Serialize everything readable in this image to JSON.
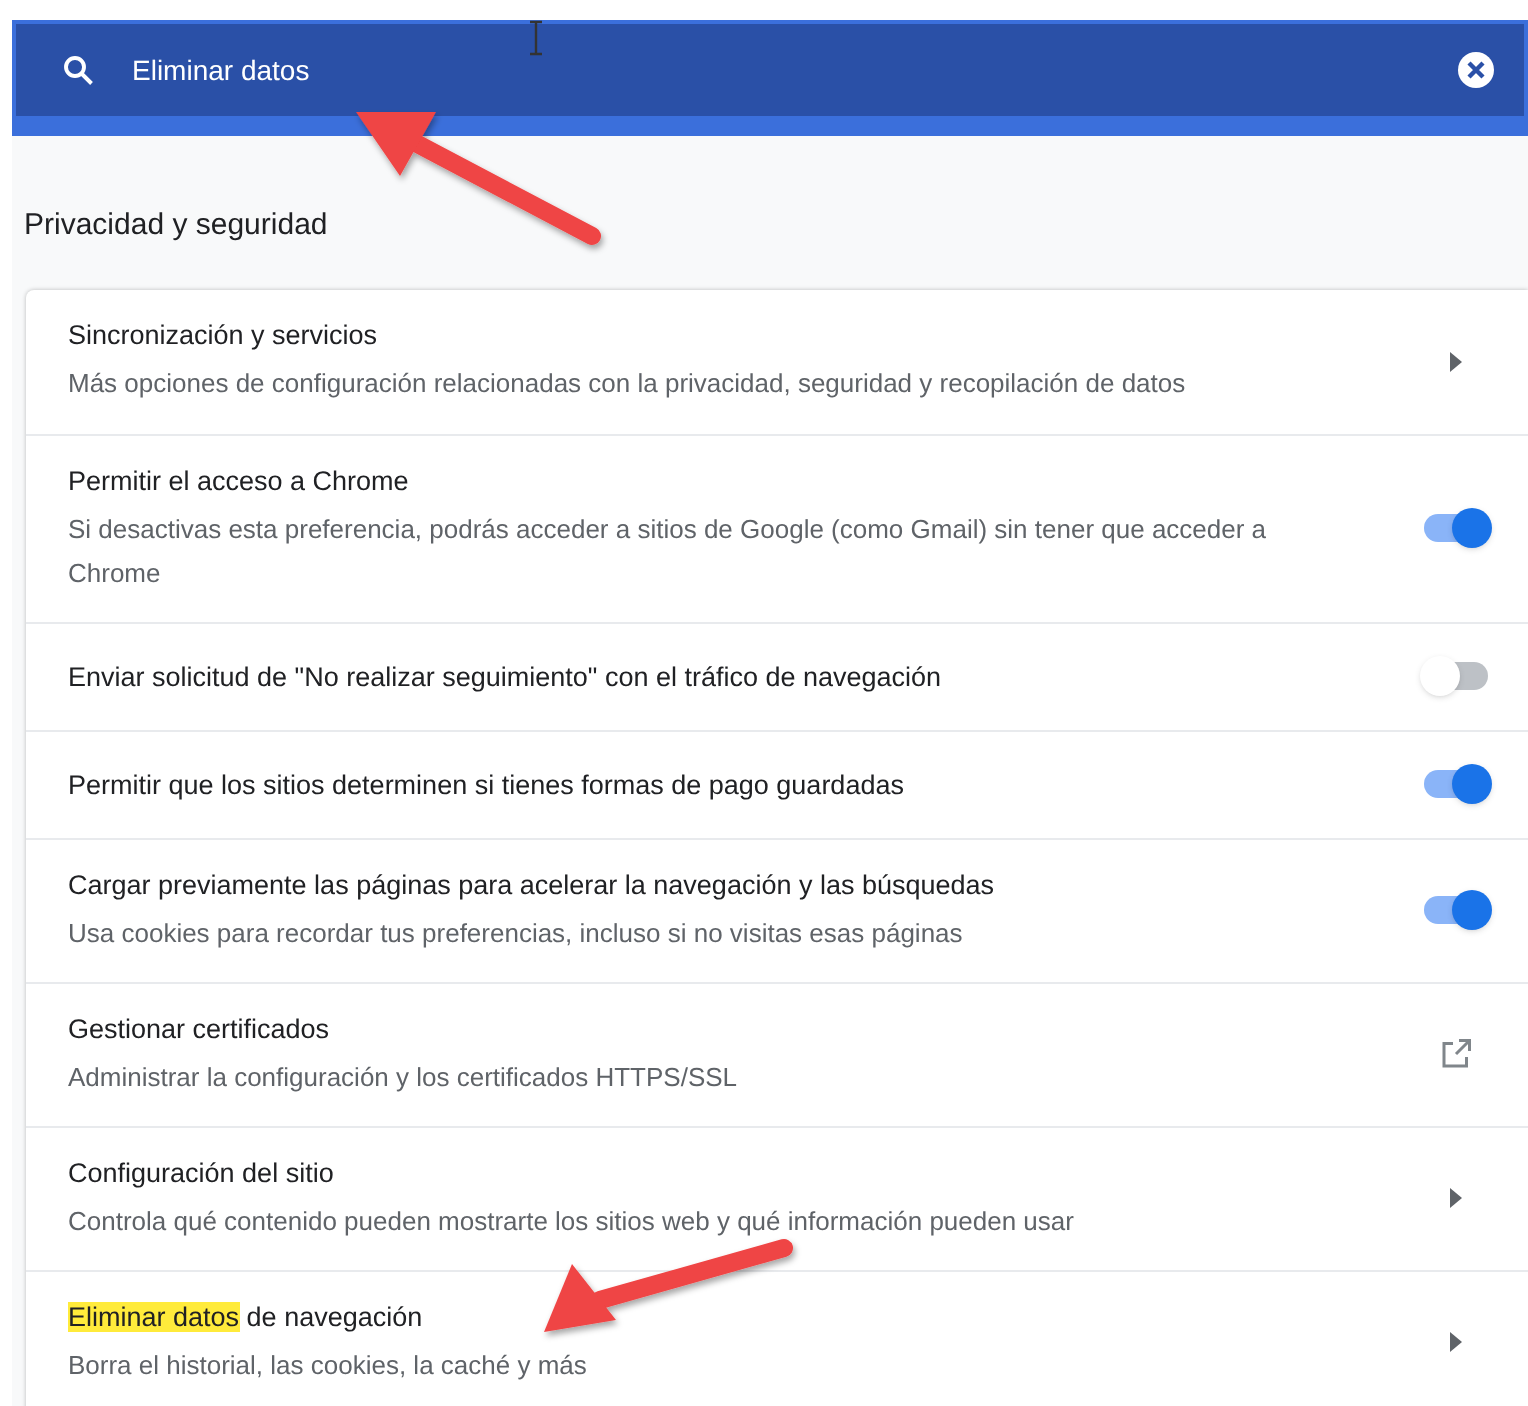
{
  "search": {
    "value": "Eliminar datos"
  },
  "section_title": "Privacidad y seguridad",
  "rows": [
    {
      "kind": "arrow",
      "title_parts": [
        {
          "text": "Sincronización y servicios",
          "highlighted": false
        }
      ],
      "subtitle": "Más opciones de configuración relacionadas con la privacidad, seguridad y recopilación de datos"
    },
    {
      "kind": "toggle",
      "on": true,
      "title_parts": [
        {
          "text": "Permitir el acceso a Chrome",
          "highlighted": false
        }
      ],
      "subtitle": "Si desactivas esta preferencia, podrás acceder a sitios de Google (como Gmail) sin tener que acceder a Chrome"
    },
    {
      "kind": "toggle",
      "on": false,
      "title_parts": [
        {
          "text": "Enviar solicitud de \"No realizar seguimiento\" con el tráfico de navegación",
          "highlighted": false
        }
      ]
    },
    {
      "kind": "toggle",
      "on": true,
      "title_parts": [
        {
          "text": "Permitir que los sitios determinen si tienes formas de pago guardadas",
          "highlighted": false
        }
      ]
    },
    {
      "kind": "toggle",
      "on": true,
      "title_parts": [
        {
          "text": "Cargar previamente las páginas para acelerar la navegación y las búsquedas",
          "highlighted": false
        }
      ],
      "subtitle": "Usa cookies para recordar tus preferencias, incluso si no visitas esas páginas"
    },
    {
      "kind": "external",
      "title_parts": [
        {
          "text": "Gestionar certificados",
          "highlighted": false
        }
      ],
      "subtitle": "Administrar la configuración y los certificados HTTPS/SSL"
    },
    {
      "kind": "arrow",
      "title_parts": [
        {
          "text": "Configuración del sitio",
          "highlighted": false
        }
      ],
      "subtitle": "Controla qué contenido pueden mostrarte los sitios web y qué información pueden usar"
    },
    {
      "kind": "arrow",
      "title_parts": [
        {
          "text": "Eliminar datos",
          "highlighted": true
        },
        {
          "text": " de navegación",
          "highlighted": false
        }
      ],
      "subtitle": "Borra el historial, las cookies, la caché y más"
    }
  ]
}
